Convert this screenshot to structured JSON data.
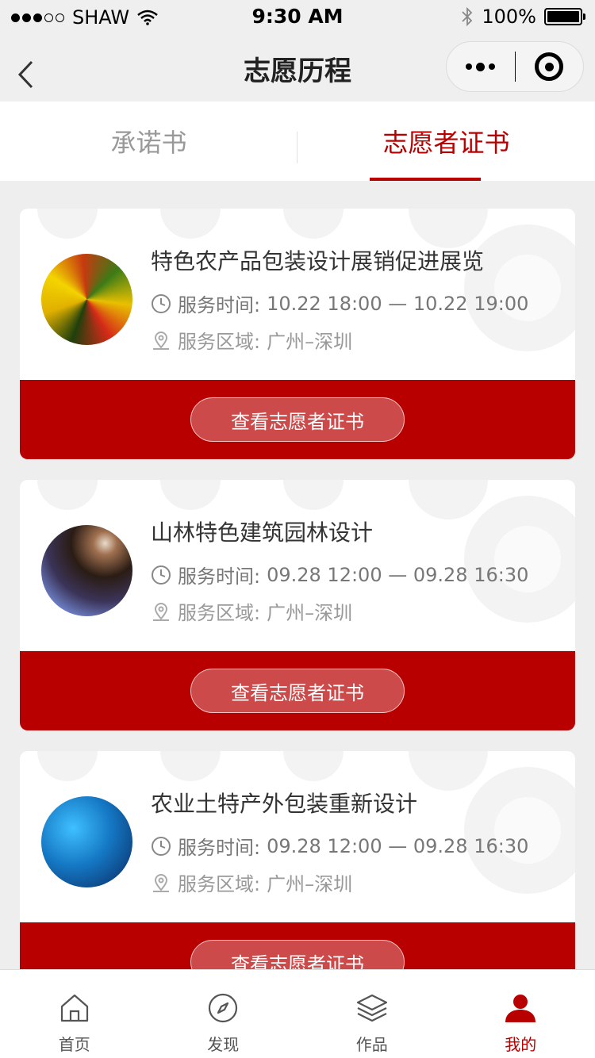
{
  "status_bar": {
    "carrier": "SHAW",
    "time": "9:30 AM",
    "battery": "100%"
  },
  "nav": {
    "title": "志愿历程"
  },
  "tabs": [
    {
      "label": "承诺书",
      "active": false
    },
    {
      "label": "志愿者证书",
      "active": true
    }
  ],
  "cards": [
    {
      "title": "特色农产品包装设计展销促进展览",
      "time_label": "服务时间:",
      "time_value": "10.22 18:00 — 10.22 19:00",
      "area_label": "服务区域:",
      "area_value": "广州–深圳",
      "button": "查看志愿者证书"
    },
    {
      "title": "山林特色建筑园林设计",
      "time_label": "服务时间:",
      "time_value": "09.28 12:00 — 09.28 16:30",
      "area_label": "服务区域:",
      "area_value": "广州–深圳",
      "button": "查看志愿者证书"
    },
    {
      "title": "农业土特产外包装重新设计",
      "time_label": "服务时间:",
      "time_value": "09.28 12:00 — 09.28 16:30",
      "area_label": "服务区域:",
      "area_value": "广州–深圳",
      "button": "查看志愿者证书"
    }
  ],
  "tab_bar": [
    {
      "label": "首页",
      "icon": "home-icon",
      "active": false
    },
    {
      "label": "发现",
      "icon": "compass-icon",
      "active": false
    },
    {
      "label": "作品",
      "icon": "layers-icon",
      "active": false
    },
    {
      "label": "我的",
      "icon": "user-icon",
      "active": true
    }
  ],
  "colors": {
    "accent": "#b80000",
    "button_bg": "#cc4a4a",
    "background": "#eeeeee"
  }
}
